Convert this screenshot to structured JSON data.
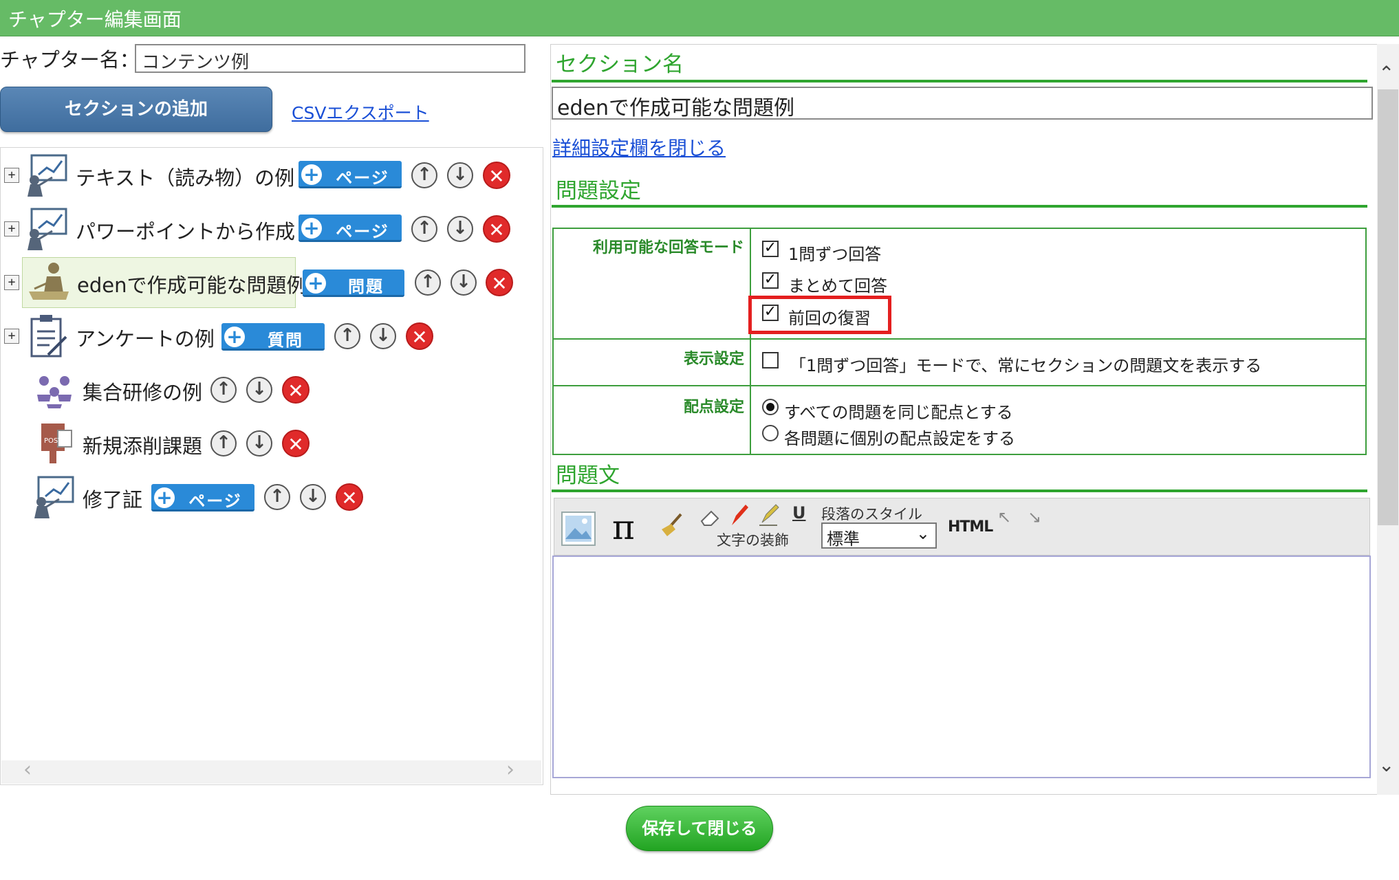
{
  "header": {
    "title": "チャプター編集画面"
  },
  "chapter": {
    "name_label": "チャプター名：",
    "name_value": "コンテンツ例"
  },
  "toolbar_left": {
    "add_section_label": "セクションの追加",
    "csv_export_label": "CSVエクスポート"
  },
  "sections": [
    {
      "label": "テキスト（読み物）の例",
      "icon": "presentation-icon",
      "add_label": "ページ"
    },
    {
      "label": "パワーポイントから作成",
      "icon": "presentation-icon",
      "add_label": "ページ"
    },
    {
      "label": "edenで作成可能な問題例",
      "icon": "student-writing-icon",
      "add_label": "問題",
      "selected": true
    },
    {
      "label": "アンケートの例",
      "icon": "clipboard-icon",
      "add_label": "質問"
    },
    {
      "label": "集合研修の例",
      "icon": "group-training-icon"
    },
    {
      "label": "新規添削課題",
      "icon": "post-box-icon"
    },
    {
      "label": "修了証",
      "icon": "presentation-icon",
      "add_label": "ページ"
    }
  ],
  "right": {
    "section_name_heading": "セクション名",
    "section_name_value": "edenで作成可能な問題例",
    "detail_toggle_link": "詳細設定欄を閉じる",
    "question_settings_heading": "問題設定",
    "question_text_heading": "問題文"
  },
  "settings": {
    "answer_mode_label": "利用可能な回答モード",
    "answer_modes": [
      {
        "label": "1問ずつ回答",
        "checked": true
      },
      {
        "label": "まとめて回答",
        "checked": true
      },
      {
        "label": "前回の復習",
        "checked": true
      }
    ],
    "display_label": "表示設定",
    "display_option": {
      "label": "「1問ずつ回答」モードで、常にセクションの問題文を表示する",
      "checked": false
    },
    "scoring_label": "配点設定",
    "scoring_options": [
      {
        "label": "すべての問題を同じ配点とする",
        "selected": true
      },
      {
        "label": "各問題に個別の配点設定をする",
        "selected": false
      }
    ]
  },
  "editor_toolbar": {
    "text_decoration_label": "文字の装飾",
    "paragraph_style_label": "段落のスタイル",
    "paragraph_style_value": "標準",
    "html_label": "HTML",
    "underline_label": "U",
    "pi_label": "π"
  },
  "footer": {
    "save_close_label": "保存して閉じる"
  },
  "colors": {
    "header_green": "#66bb66",
    "accent_green": "#2fa52f",
    "pill_blue": "#2a8ad8",
    "delete_red": "#e02a2a",
    "highlight_red": "#e41f1f"
  }
}
